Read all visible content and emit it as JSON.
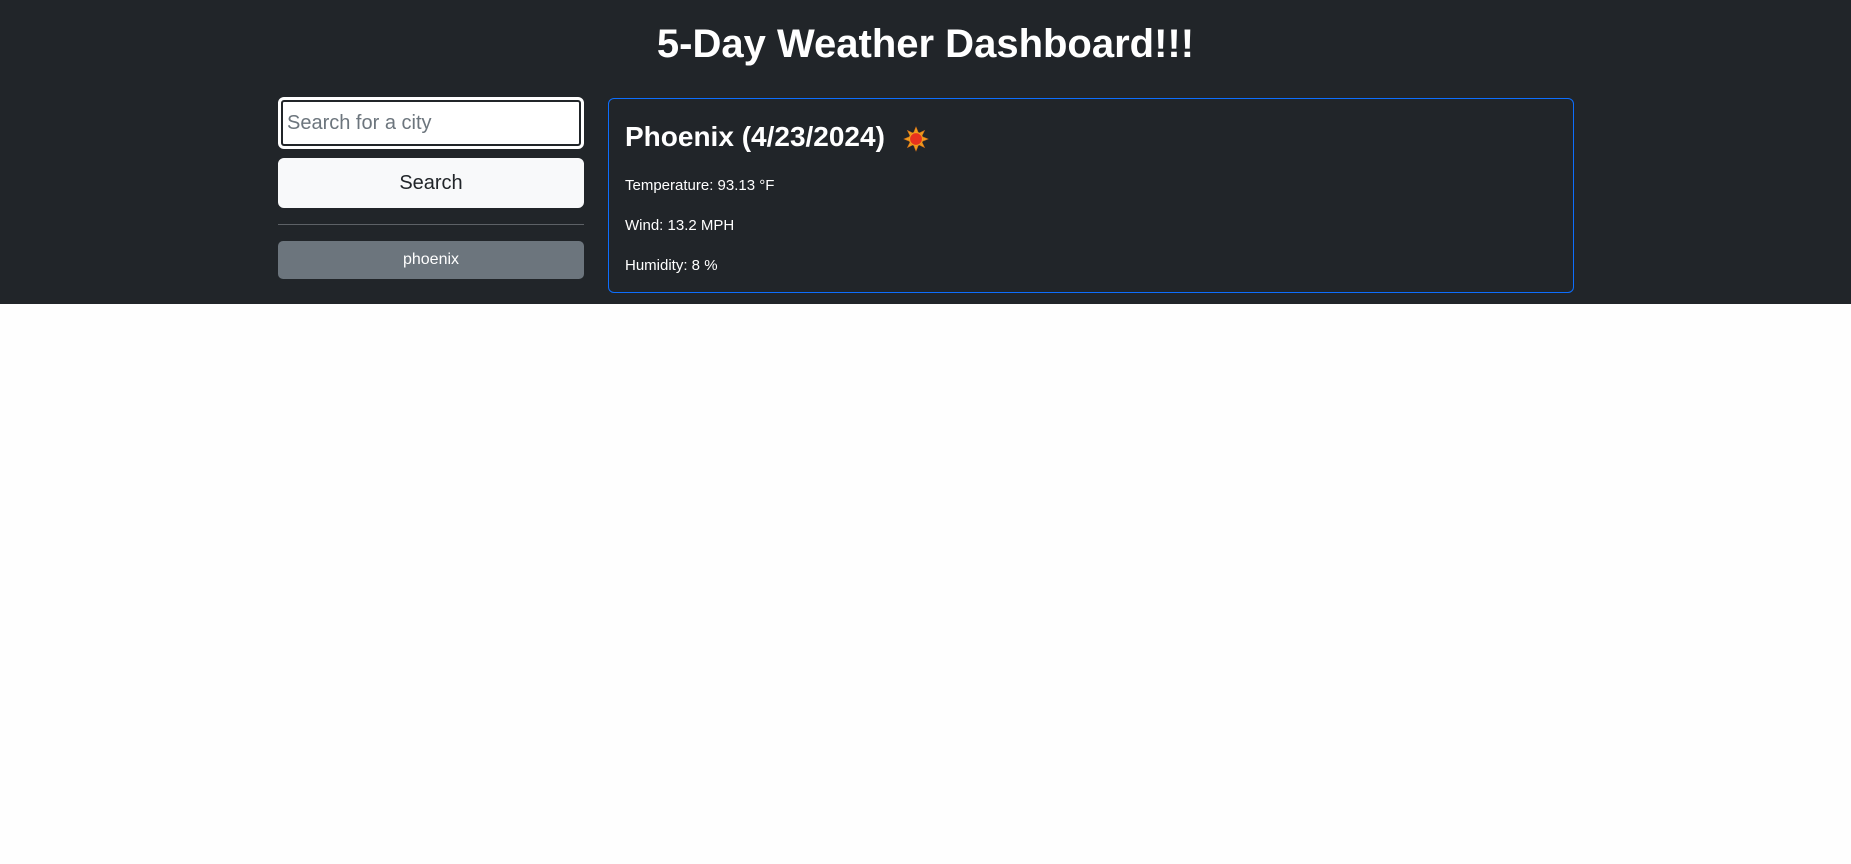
{
  "header": {
    "title": "5-Day Weather Dashboard!!!"
  },
  "sidebar": {
    "search_placeholder": "Search for a city",
    "search_value": "",
    "search_button_label": "Search",
    "history": [
      {
        "label": "phoenix"
      }
    ]
  },
  "current": {
    "city_date": "Phoenix (4/23/2024)",
    "icon": "sun-icon",
    "temperature": "Temperature: 93.13 °F",
    "wind": "Wind: 13.2 MPH",
    "humidity": "Humidity: 8 %"
  },
  "colors": {
    "background_dark": "#212529",
    "card_border": "#0d6efd",
    "search_button_bg": "#f8f9fa",
    "history_button_bg": "#6c757d"
  }
}
